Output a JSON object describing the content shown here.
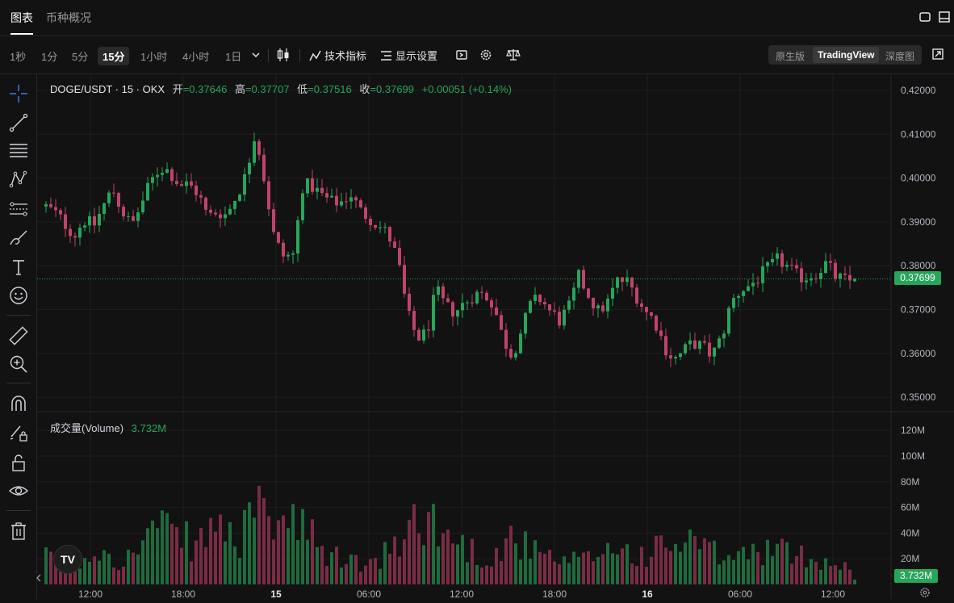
{
  "top_tabs": [
    "图表",
    "币种概况"
  ],
  "timeframes": [
    "1秒",
    "1分",
    "5分",
    "15分",
    "1小时",
    "4小时",
    "1日"
  ],
  "active_timeframe": "15分",
  "toolbar": {
    "indicators_label": "技术指标",
    "display_label": "显示设置"
  },
  "view_modes": [
    "原生版",
    "TradingView",
    "深度图"
  ],
  "active_view_mode": "TradingView",
  "legend": {
    "symbol": "DOGE/USDT · 15 · OKX",
    "open_label": "开",
    "open": "=0.37646",
    "high_label": "高",
    "high": "=0.37707",
    "low_label": "低",
    "low": "=0.37516",
    "close_label": "收",
    "close": "=0.37699",
    "change": "+0.00051 (+0.14%)"
  },
  "volume_legend": {
    "label": "成交量(Volume)",
    "value": "3.732M"
  },
  "current_price": "0.37699",
  "current_volume": "3.732M",
  "logo_text": "TV",
  "colors": {
    "up": "#26a65b",
    "down": "#c2436a",
    "vol_up": "#1f6b3e",
    "vol_down": "#7a2c45",
    "bg": "#121212"
  },
  "chart_data": {
    "type": "candlestick",
    "price_axis_ticks": [
      "0.42000",
      "0.41000",
      "0.40000",
      "0.39000",
      "0.38000",
      "0.37000",
      "0.36000",
      "0.35000"
    ],
    "price_ylim": [
      0.3467,
      0.4222
    ],
    "volume_axis_ticks": [
      "120M",
      "100M",
      "80M",
      "60M",
      "40M",
      "20M"
    ],
    "volume_ylim": [
      0,
      127
    ],
    "time_axis_ticks": [
      "12:00",
      "18:00",
      "15",
      "06:00",
      "12:00",
      "18:00",
      "16",
      "06:00",
      "12:00"
    ],
    "price_anchors": [
      0.3935,
      0.392,
      0.3895,
      0.387,
      0.3905,
      0.389,
      0.3935,
      0.3975,
      0.3925,
      0.389,
      0.394,
      0.399,
      0.4025,
      0.4015,
      0.3985,
      0.3985,
      0.3965,
      0.391,
      0.3925,
      0.3915,
      0.396,
      0.4005,
      0.411,
      0.399,
      0.386,
      0.382,
      0.3825,
      0.3985,
      0.398,
      0.396,
      0.3945,
      0.3945,
      0.3965,
      0.3925,
      0.391,
      0.389,
      0.387,
      0.381,
      0.369,
      0.3635,
      0.3645,
      0.3745,
      0.3705,
      0.3695,
      0.3715,
      0.3735,
      0.3735,
      0.3715,
      0.3635,
      0.3595,
      0.3655,
      0.3715,
      0.3725,
      0.3695,
      0.3675,
      0.3705,
      0.3775,
      0.3735,
      0.3695,
      0.3715,
      0.3765,
      0.3765,
      0.3735,
      0.3695,
      0.3675,
      0.3615,
      0.3585,
      0.3605,
      0.3625,
      0.3615,
      0.3595,
      0.3635,
      0.3715,
      0.3745,
      0.3755,
      0.3775,
      0.3795,
      0.3815,
      0.3795,
      0.3775,
      0.3775,
      0.3785,
      0.3805,
      0.3775,
      0.3765,
      0.3765
    ],
    "volume_anchors": [
      20,
      18,
      16,
      14,
      20,
      26,
      30,
      24,
      18,
      22,
      32,
      42,
      45,
      38,
      34,
      34,
      28,
      42,
      50,
      38,
      32,
      30,
      55,
      52,
      52,
      48,
      45,
      42,
      36,
      24,
      22,
      20,
      20,
      16,
      14,
      18,
      22,
      28,
      40,
      58,
      54,
      46,
      38,
      34,
      30,
      26,
      20,
      22,
      28,
      38,
      32,
      26,
      22,
      20,
      16,
      18,
      18,
      20,
      24,
      28,
      30,
      26,
      22,
      24,
      26,
      30,
      32,
      30,
      34,
      28,
      24,
      22,
      20,
      22,
      24,
      26,
      28,
      26,
      24,
      22,
      22,
      20,
      18,
      16,
      14,
      12
    ]
  }
}
